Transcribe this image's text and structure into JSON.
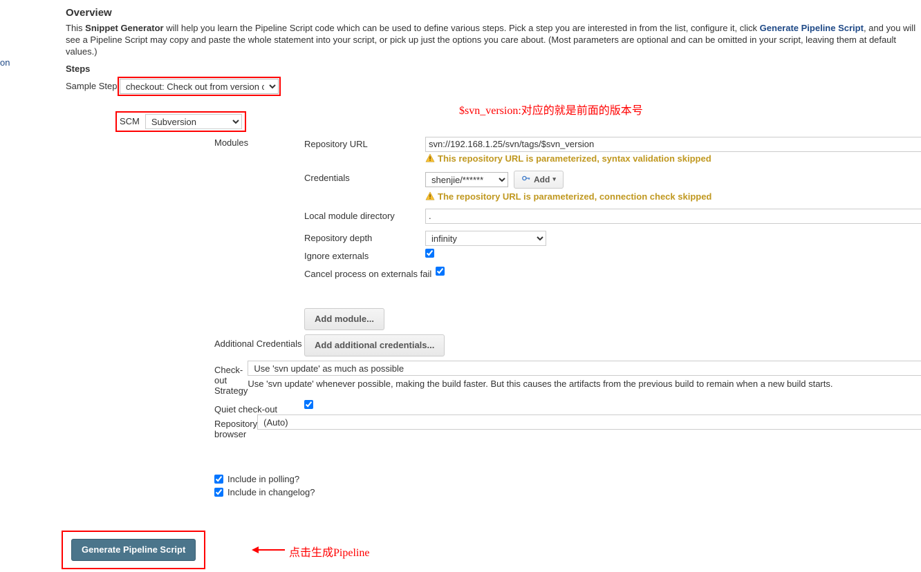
{
  "leftnav_fragment": "on",
  "overview": {
    "title": "Overview",
    "prefix": "This ",
    "snippet_gen": "Snippet Generator",
    "mid": " will help you learn the Pipeline Script code which can be used to define various steps. Pick a step you are interested in from the list, configure it, click ",
    "gen_link": "Generate Pipeline Script",
    "suffix": ", and you will see a Pipeline Script may copy and paste the whole statement into your script, or pick up just the options you care about. (Most parameters are optional and can be omitted in your script, leaving them at default values.)"
  },
  "steps": {
    "title": "Steps",
    "sample_label": "Sample Step",
    "sample_value": "checkout: Check out from version control"
  },
  "scm": {
    "label": "SCM",
    "value": "Subversion",
    "modules_label": "Modules"
  },
  "module": {
    "repo_url_label": "Repository URL",
    "repo_url_value": "svn://192.168.1.25/svn/tags/$svn_version",
    "warn1": "This repository URL is parameterized, syntax validation skipped",
    "credentials_label": "Credentials",
    "credentials_value": "shenjie/******",
    "add_label": "Add",
    "warn2": "The repository URL is parameterized, connection check skipped",
    "lmd_label": "Local module directory",
    "lmd_value": ".",
    "depth_label": "Repository depth",
    "depth_value": "infinity",
    "ignore_ext_label": "Ignore externals",
    "ignore_ext": true,
    "cancel_ext_label": "Cancel process on externals fail",
    "cancel_ext": true,
    "add_module_label": "Add module..."
  },
  "outer": {
    "add_cred_label": "Additional Credentials",
    "add_cred_btn": "Add additional credentials...",
    "checkout_label": "Check-out Strategy",
    "checkout_value": "Use 'svn update' as much as possible",
    "checkout_desc": "Use 'svn update' whenever possible, making the build faster. But this causes the artifacts from the previous build to remain when a new build starts.",
    "quiet_label": "Quiet check-out",
    "quiet": true,
    "repo_browser_label": "Repository browser",
    "repo_browser_value": "(Auto)"
  },
  "polling": {
    "include_polling": "Include in polling?",
    "include_polling_chk": true,
    "include_changelog": "Include in changelog?",
    "include_changelog_chk": true
  },
  "generate": {
    "button": "Generate Pipeline Script",
    "annotation": "点击生成Pipeline"
  },
  "top_annotation": "$svn_version:对应的就是前面的版本号"
}
